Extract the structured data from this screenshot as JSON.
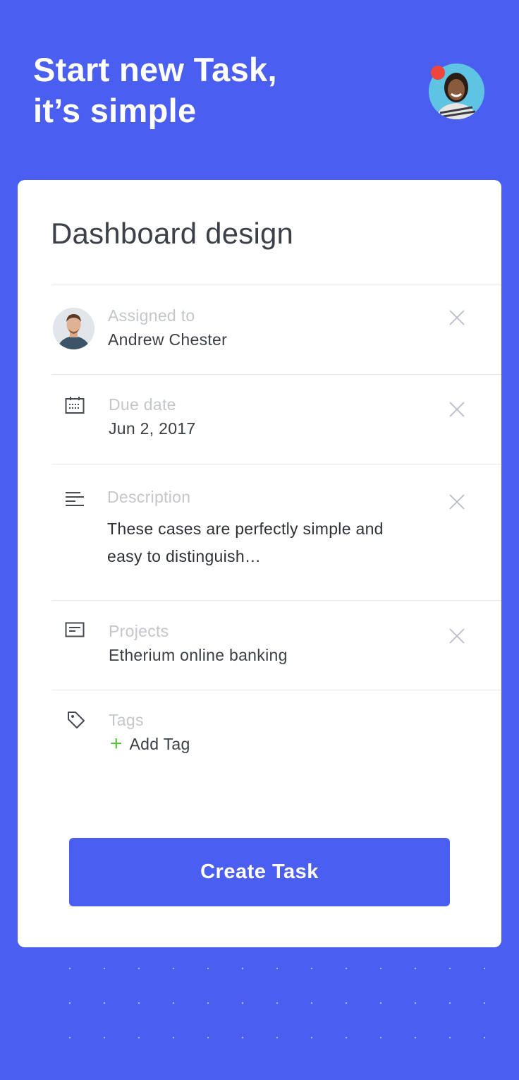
{
  "header": {
    "title_line1": "Start new Task,",
    "title_line2": "it’s simple",
    "avatar_icon": "user-avatar-icon",
    "notification_color": "#f0453c"
  },
  "card": {
    "title": "Dashboard design",
    "assigned": {
      "label": "Assigned to",
      "value": "Andrew Chester"
    },
    "due": {
      "label": "Due date",
      "value": "Jun 2, 2017",
      "icon": "calendar-icon"
    },
    "description": {
      "label": "Description",
      "value": "These cases are perfectly simple and easy to distinguish…",
      "icon": "text-lines-icon"
    },
    "projects": {
      "label": "Projects",
      "value": "Etherium online banking",
      "icon": "message-box-icon"
    },
    "tags": {
      "label": "Tags",
      "add_label": "Add Tag",
      "icon": "tag-icon"
    },
    "create_button": "Create Task"
  },
  "colors": {
    "background": "#4a5ef0",
    "accent": "#4a5ef0",
    "add_green": "#5bc23a",
    "notification_red": "#f0453c"
  }
}
